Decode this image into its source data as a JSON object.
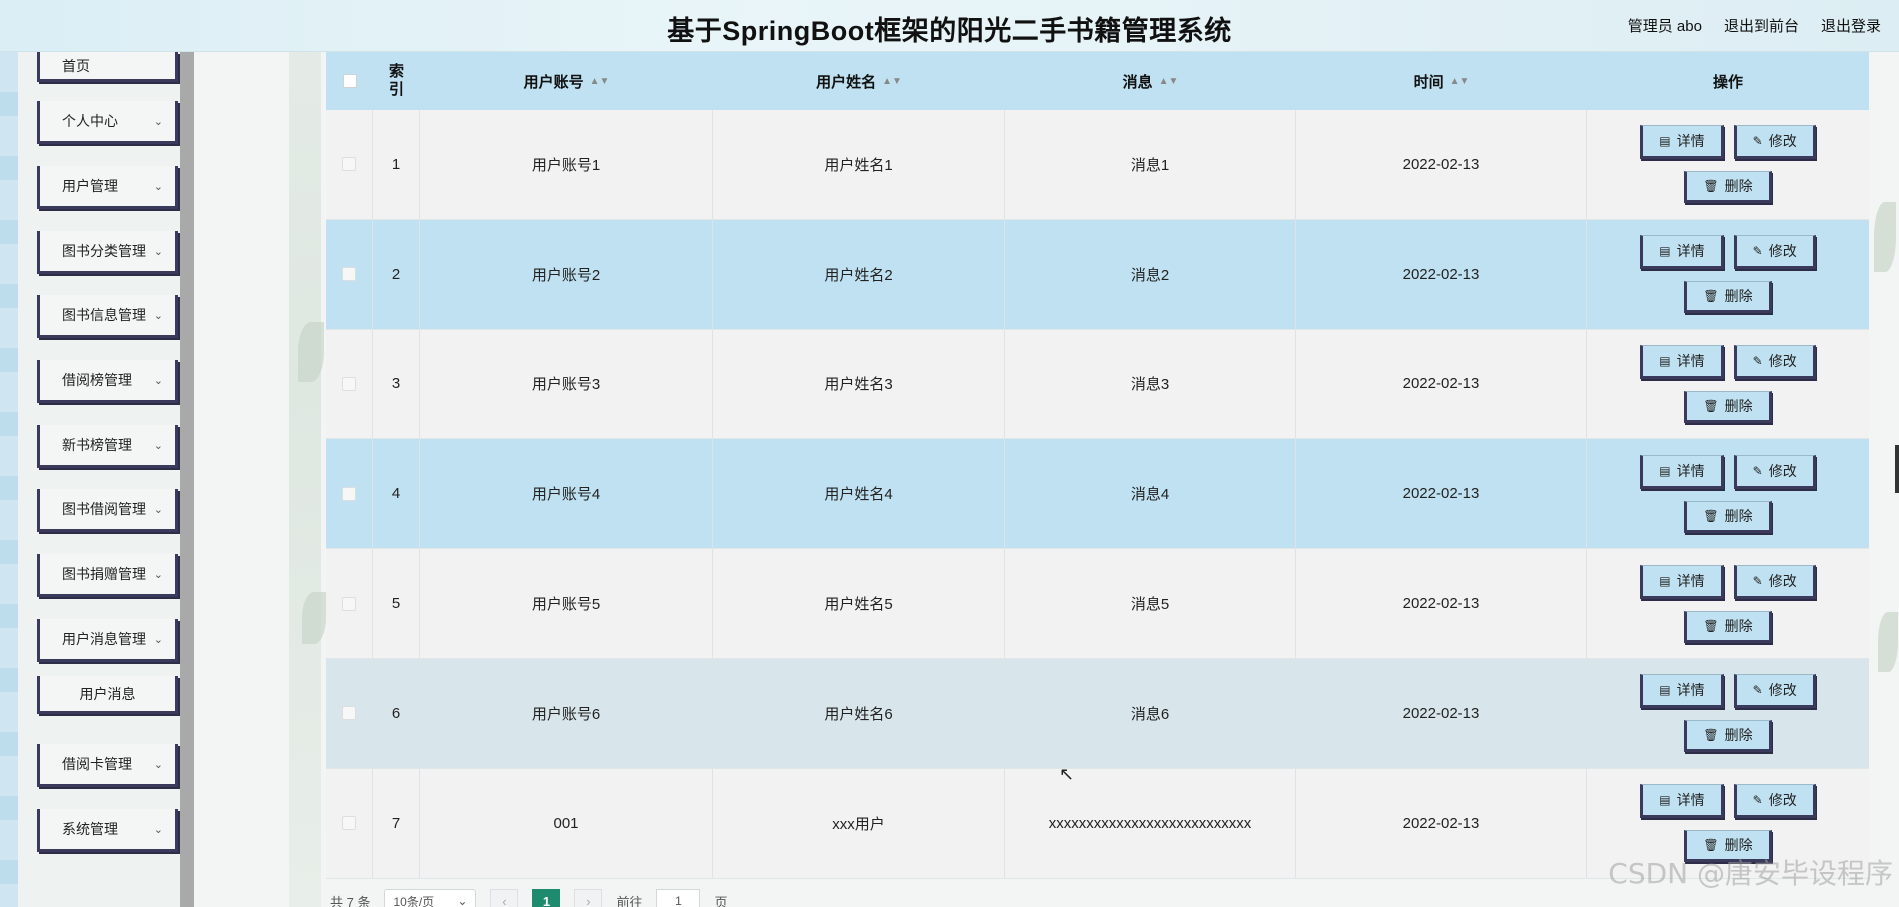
{
  "header": {
    "title": "基于SpringBoot框架的阳光二手书籍管理系统",
    "user_label": "管理员 abo",
    "front_label": "退出到前台",
    "logout_label": "退出登录"
  },
  "sidebar": {
    "items": [
      {
        "label": "首页"
      },
      {
        "label": "个人中心"
      },
      {
        "label": "用户管理"
      },
      {
        "label": "图书分类管理"
      },
      {
        "label": "图书信息管理"
      },
      {
        "label": "借阅榜管理"
      },
      {
        "label": "新书榜管理"
      },
      {
        "label": "图书借阅管理"
      },
      {
        "label": "图书捐赠管理"
      },
      {
        "label": "用户消息管理"
      },
      {
        "label": "用户消息"
      },
      {
        "label": "借阅卡管理"
      },
      {
        "label": "系统管理"
      }
    ]
  },
  "table": {
    "headers": {
      "index": "索引",
      "account": "用户账号",
      "name": "用户姓名",
      "message": "消息",
      "time": "时间",
      "operation": "操作"
    },
    "buttons": {
      "detail": "详情",
      "edit": "修改",
      "delete": "删除"
    },
    "rows": [
      {
        "index": "1",
        "account": "用户账号1",
        "name": "用户姓名1",
        "message": "消息1",
        "time": "2022-02-13"
      },
      {
        "index": "2",
        "account": "用户账号2",
        "name": "用户姓名2",
        "message": "消息2",
        "time": "2022-02-13"
      },
      {
        "index": "3",
        "account": "用户账号3",
        "name": "用户姓名3",
        "message": "消息3",
        "time": "2022-02-13"
      },
      {
        "index": "4",
        "account": "用户账号4",
        "name": "用户姓名4",
        "message": "消息4",
        "time": "2022-02-13"
      },
      {
        "index": "5",
        "account": "用户账号5",
        "name": "用户姓名5",
        "message": "消息5",
        "time": "2022-02-13"
      },
      {
        "index": "6",
        "account": "用户账号6",
        "name": "用户姓名6",
        "message": "消息6",
        "time": "2022-02-13"
      },
      {
        "index": "7",
        "account": "001",
        "name": "xxx用户",
        "message": "xxxxxxxxxxxxxxxxxxxxxxxxxxx",
        "time": "2022-02-13"
      }
    ]
  },
  "pager": {
    "total": "共 7 条",
    "page_size": "10条/页",
    "current_page": "1",
    "goto_label": "前往",
    "goto_value": "1",
    "page_unit": "页"
  },
  "watermark": "CSDN @唐安毕设程序",
  "colors": {
    "header_bg": "#dbeef5",
    "row_highlight": "#bfe1f1",
    "button_border": "#3a3a5c",
    "page_active": "#1e8a6e"
  }
}
